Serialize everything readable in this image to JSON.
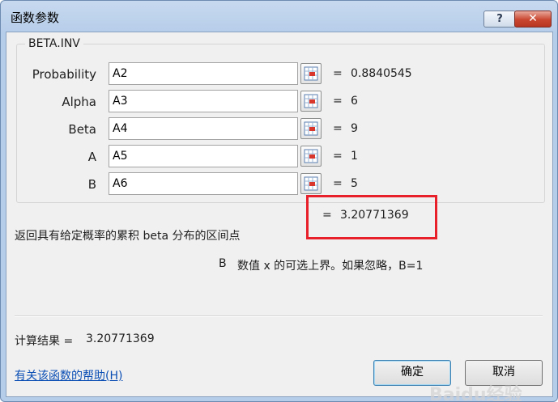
{
  "window": {
    "title": "函数参数",
    "help_button": "?",
    "close_button": "✕"
  },
  "function": {
    "name": "BETA.INV",
    "args": [
      {
        "label": "Probability",
        "value": "A2",
        "result": "0.8840545"
      },
      {
        "label": "Alpha",
        "value": "A3",
        "result": "6"
      },
      {
        "label": "Beta",
        "value": "A4",
        "result": "9"
      },
      {
        "label": "A",
        "value": "A5",
        "result": "1"
      },
      {
        "label": "B",
        "value": "A6",
        "result": "5"
      }
    ],
    "equals": "=",
    "result": "3.20771369",
    "description": "返回具有给定概率的累积 beta 分布的区间点",
    "param_name": "B",
    "param_description": "数值 x 的可选上界。如果忽略，B=1"
  },
  "footer": {
    "calc_label": "计算结果 =",
    "calc_value": "3.20771369",
    "help_link": "有关该函数的帮助(H)",
    "ok_label": "确定",
    "cancel_label": "取消"
  },
  "icons": {
    "ref": "collapse-dialog-icon"
  },
  "colors": {
    "highlight_border": "#e8202a",
    "link": "#0b4fb5"
  },
  "watermark": "Baidu经验"
}
